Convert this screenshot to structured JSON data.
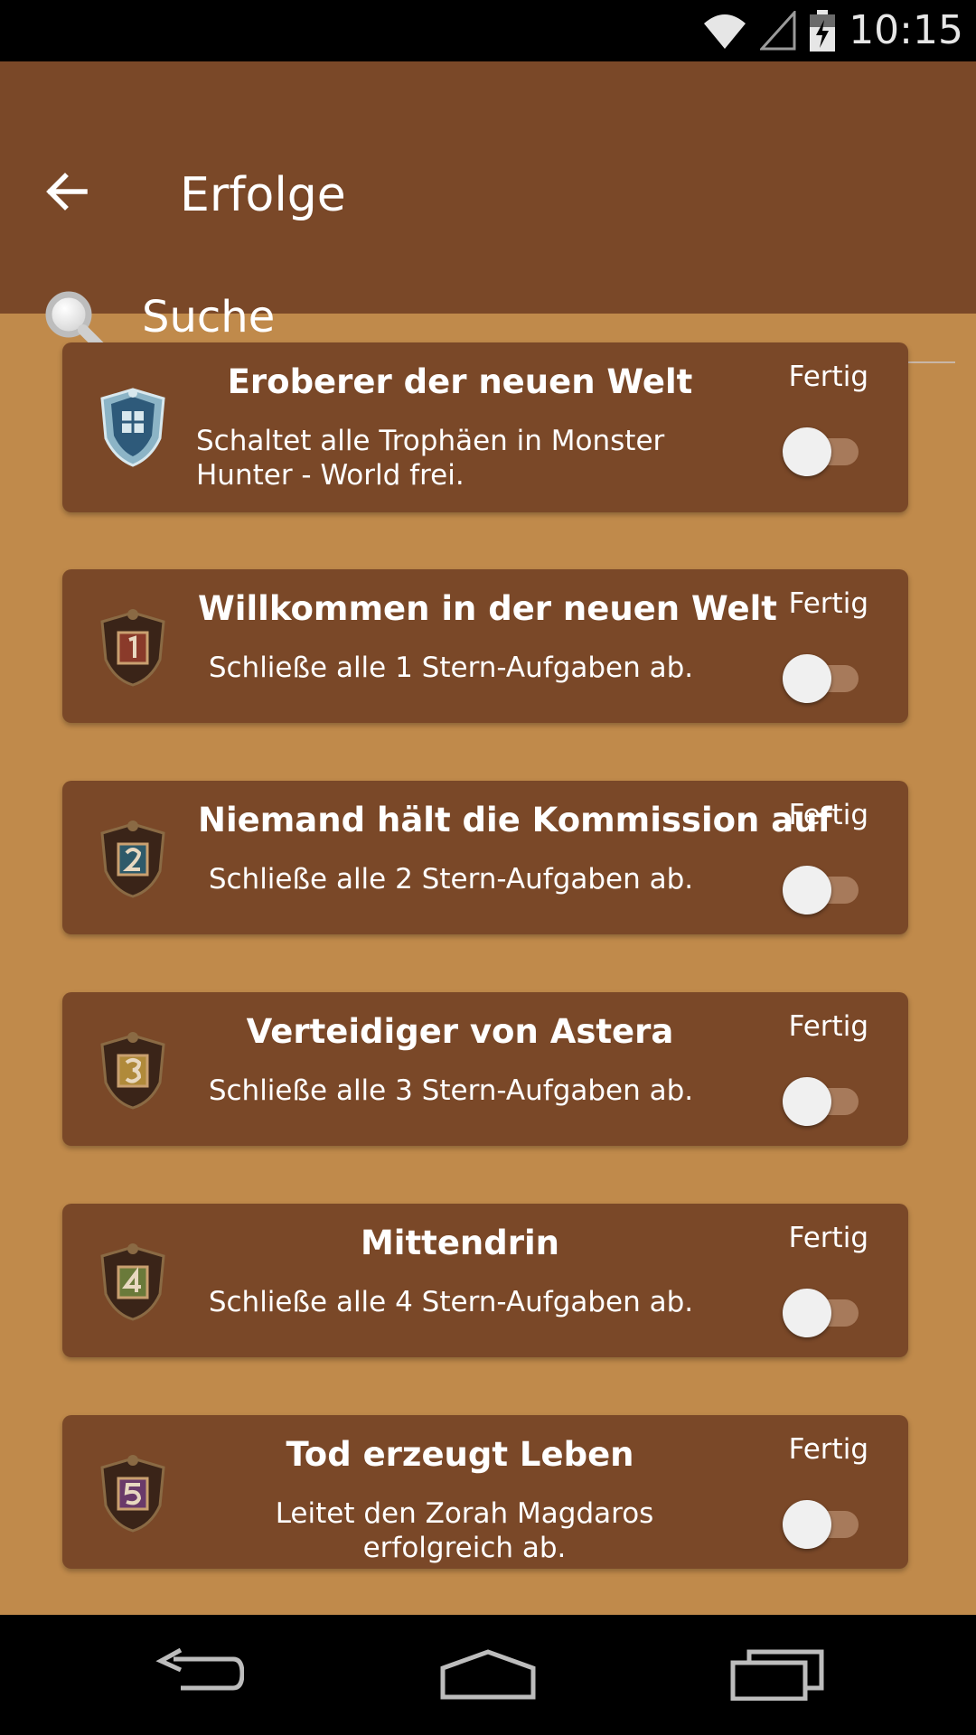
{
  "status_bar": {
    "time": "10:15",
    "icons": [
      "wifi-icon",
      "signal-icon",
      "battery-charging-icon"
    ]
  },
  "app_bar": {
    "title": "Erfolge",
    "back_icon": "back-arrow-icon",
    "search": {
      "icon": "search-icon",
      "placeholder": "Suche",
      "value": ""
    }
  },
  "colors": {
    "app_bar": "#7A4828",
    "background": "#C08A4B",
    "card": "#7A4828"
  },
  "achievements": [
    {
      "title": "Eroberer der neuen Welt",
      "description": "Schaltet alle Trophäen in Monster Hunter - World frei.",
      "done_label": "Fertig",
      "done": false,
      "emblem": "crest-emblem-icon"
    },
    {
      "title": "Willkommen in der neuen Welt",
      "description": "Schließe alle 1 Stern-Aufgaben ab.",
      "done_label": "Fertig",
      "done": false,
      "emblem": "rank-1-emblem-icon"
    },
    {
      "title": "Niemand hält die Kommission auf",
      "description": "Schließe alle 2 Stern-Aufgaben ab.",
      "done_label": "Fertig",
      "done": false,
      "emblem": "rank-2-emblem-icon"
    },
    {
      "title": "Verteidiger von Astera",
      "description": "Schließe alle 3 Stern-Aufgaben ab.",
      "done_label": "Fertig",
      "done": false,
      "emblem": "rank-3-emblem-icon"
    },
    {
      "title": "Mittendrin",
      "description": "Schließe alle 4 Stern-Aufgaben ab.",
      "done_label": "Fertig",
      "done": false,
      "emblem": "rank-4-emblem-icon"
    },
    {
      "title": "Tod erzeugt Leben",
      "description": "Leitet den Zorah Magdaros erfolgreich ab.",
      "done_label": "Fertig",
      "done": false,
      "emblem": "rank-5-emblem-icon"
    }
  ],
  "nav_bar": {
    "icons": [
      "back-nav-icon",
      "home-nav-icon",
      "recents-nav-icon"
    ]
  }
}
